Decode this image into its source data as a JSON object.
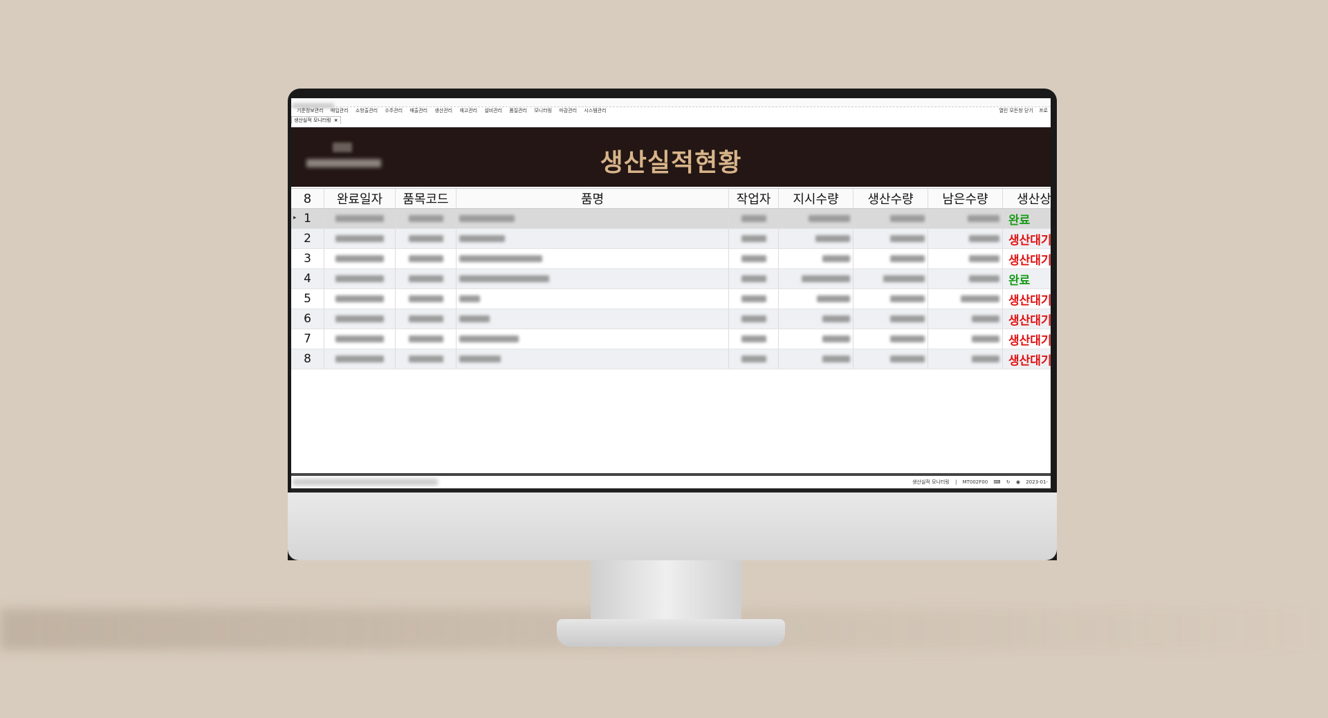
{
  "menu": {
    "items": [
      "기준정보관리",
      "매입관리",
      "소방출관리",
      "수주관리",
      "매출관리",
      "생산관리",
      "재고관리",
      "설비관리",
      "품질관리",
      "모니터링",
      "마감관리",
      "시스템관리"
    ],
    "right_links": [
      "열린 모든창 닫기",
      "프로"
    ]
  },
  "tab": {
    "label": "생산실적 모니터링",
    "close": "×"
  },
  "banner": {
    "title": "생산실적현황"
  },
  "grid": {
    "row_count_label": "8",
    "columns": [
      "완료일자",
      "품목코드",
      "품명",
      "작업자",
      "지시수량",
      "생산수량",
      "남은수량",
      "생산상"
    ],
    "rows": [
      {
        "no": "1",
        "status": "완료",
        "status_color": "#1a9c1a"
      },
      {
        "no": "2",
        "status": "생산대기",
        "status_color": "#e01010"
      },
      {
        "no": "3",
        "status": "생산대기",
        "status_color": "#e01010"
      },
      {
        "no": "4",
        "status": "완료",
        "status_color": "#1a9c1a"
      },
      {
        "no": "5",
        "status": "생산대기",
        "status_color": "#e01010"
      },
      {
        "no": "6",
        "status": "생산대기",
        "status_color": "#e01010"
      },
      {
        "no": "7",
        "status": "생산대기",
        "status_color": "#e01010"
      },
      {
        "no": "8",
        "status": "생산대기",
        "status_color": "#e01010"
      }
    ]
  },
  "statusbar": {
    "screen_name": "생산실적 모니터링",
    "separator": "|",
    "screen_code": "MT002F00",
    "date": "2023-01-"
  },
  "colors": {
    "banner_bg": "#231614",
    "banner_title": "#d7b48a",
    "wall": "#d8ccbe"
  }
}
